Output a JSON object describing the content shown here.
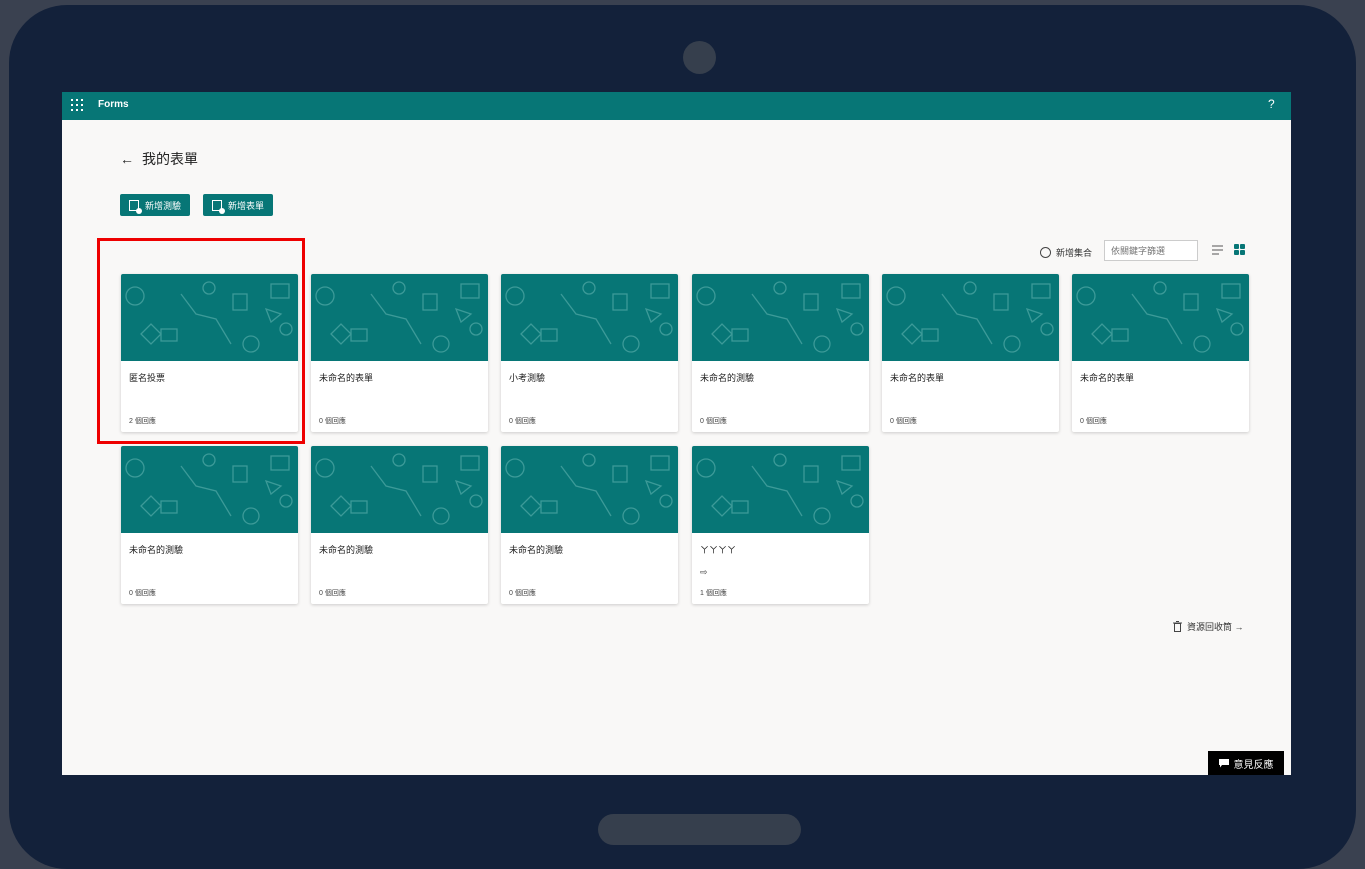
{
  "app": {
    "name": "Forms",
    "help": "?"
  },
  "page": {
    "title": "我的表單"
  },
  "toolbar": {
    "new_quiz": "新增測驗",
    "new_form": "新增表單"
  },
  "filters": {
    "new_collection": "新增集合",
    "search_placeholder": "依關鍵字篩選"
  },
  "forms": [
    {
      "title": "匿名投票",
      "responses": "2 個回應"
    },
    {
      "title": "未命名的表單",
      "responses": "0 個回應"
    },
    {
      "title": "小考測驗",
      "responses": "0 個回應"
    },
    {
      "title": "未命名的測驗",
      "responses": "0 個回應"
    },
    {
      "title": "未命名的表單",
      "responses": "0 個回應"
    },
    {
      "title": "未命名的表單",
      "responses": "0 個回應"
    },
    {
      "title": "未命名的測驗",
      "responses": "0 個回應"
    },
    {
      "title": "未命名的測驗",
      "responses": "0 個回應"
    },
    {
      "title": "未命名的測驗",
      "responses": "0 個回應"
    },
    {
      "title": "ㄚㄚㄚㄚ",
      "responses": "1 個回應",
      "flag": "⇨"
    }
  ],
  "recycle_bin": "資源回收筒 →",
  "feedback": "意見反應",
  "colors": {
    "brand": "#077676",
    "highlight": "#ee0000",
    "tablet": "#13213a"
  }
}
